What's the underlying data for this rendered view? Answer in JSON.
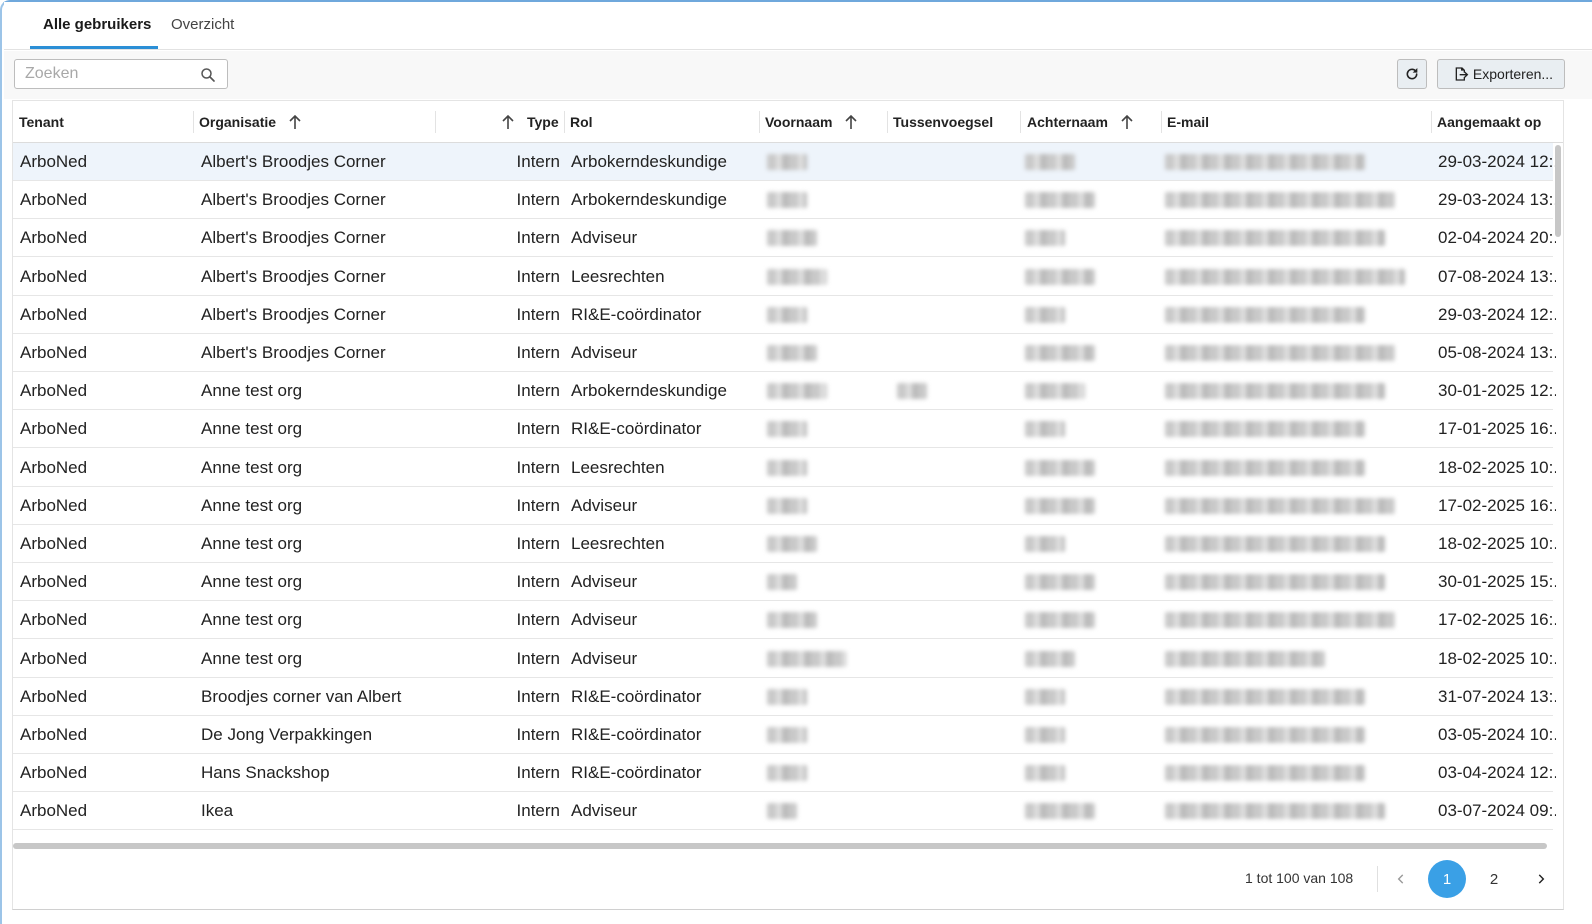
{
  "tabs": [
    {
      "label": "Alle gebruikers",
      "active": true
    },
    {
      "label": "Overzicht",
      "active": false
    }
  ],
  "toolbar": {
    "search_placeholder": "Zoeken",
    "search_value": "",
    "export_label": "Exporteren..."
  },
  "columns": {
    "tenant": "Tenant",
    "organisatie": "Organisatie",
    "type": "Type",
    "rol": "Rol",
    "voornaam": "Voornaam",
    "tussenvoegsel": "Tussenvoegsel",
    "achternaam": "Achternaam",
    "email": "E-mail",
    "aangemaakt": "Aangemaakt op"
  },
  "rows": [
    {
      "tenant": "ArboNed",
      "organisatie": "Albert's Broodjes Corner",
      "type": "Intern",
      "rol": "Arbokerndeskundige",
      "aangemaakt": "29-03-2024 12:.",
      "selected": true
    },
    {
      "tenant": "ArboNed",
      "organisatie": "Albert's Broodjes Corner",
      "type": "Intern",
      "rol": "Arbokerndeskundige",
      "aangemaakt": "29-03-2024 13:."
    },
    {
      "tenant": "ArboNed",
      "organisatie": "Albert's Broodjes Corner",
      "type": "Intern",
      "rol": "Adviseur",
      "aangemaakt": "02-04-2024 20:."
    },
    {
      "tenant": "ArboNed",
      "organisatie": "Albert's Broodjes Corner",
      "type": "Intern",
      "rol": "Leesrechten",
      "aangemaakt": "07-08-2024 13:."
    },
    {
      "tenant": "ArboNed",
      "organisatie": "Albert's Broodjes Corner",
      "type": "Intern",
      "rol": "RI&E-coördinator",
      "aangemaakt": "29-03-2024 12:."
    },
    {
      "tenant": "ArboNed",
      "organisatie": "Albert's Broodjes Corner",
      "type": "Intern",
      "rol": "Adviseur",
      "aangemaakt": "05-08-2024 13:."
    },
    {
      "tenant": "ArboNed",
      "organisatie": "Anne test org",
      "type": "Intern",
      "rol": "Arbokerndeskundige",
      "aangemaakt": "30-01-2025 12:.",
      "tussen": true
    },
    {
      "tenant": "ArboNed",
      "organisatie": "Anne test org",
      "type": "Intern",
      "rol": "RI&E-coördinator",
      "aangemaakt": "17-01-2025 16:."
    },
    {
      "tenant": "ArboNed",
      "organisatie": "Anne test org",
      "type": "Intern",
      "rol": "Leesrechten",
      "aangemaakt": "18-02-2025 10:."
    },
    {
      "tenant": "ArboNed",
      "organisatie": "Anne test org",
      "type": "Intern",
      "rol": "Adviseur",
      "aangemaakt": "17-02-2025 16:."
    },
    {
      "tenant": "ArboNed",
      "organisatie": "Anne test org",
      "type": "Intern",
      "rol": "Leesrechten",
      "aangemaakt": "18-02-2025 10:."
    },
    {
      "tenant": "ArboNed",
      "organisatie": "Anne test org",
      "type": "Intern",
      "rol": "Adviseur",
      "aangemaakt": "30-01-2025 15:."
    },
    {
      "tenant": "ArboNed",
      "organisatie": "Anne test org",
      "type": "Intern",
      "rol": "Adviseur",
      "aangemaakt": "17-02-2025 16:."
    },
    {
      "tenant": "ArboNed",
      "organisatie": "Anne test org",
      "type": "Intern",
      "rol": "Adviseur",
      "aangemaakt": "18-02-2025 10:."
    },
    {
      "tenant": "ArboNed",
      "organisatie": "Broodjes corner van Albert",
      "type": "Intern",
      "rol": "RI&E-coördinator",
      "aangemaakt": "31-07-2024 13:."
    },
    {
      "tenant": "ArboNed",
      "organisatie": "De Jong Verpakkingen",
      "type": "Intern",
      "rol": "RI&E-coördinator",
      "aangemaakt": "03-05-2024 10:."
    },
    {
      "tenant": "ArboNed",
      "organisatie": "Hans Snackshop",
      "type": "Intern",
      "rol": "RI&E-coördinator",
      "aangemaakt": "03-04-2024 12:."
    },
    {
      "tenant": "ArboNed",
      "organisatie": "Ikea",
      "type": "Intern",
      "rol": "Adviseur",
      "aangemaakt": "03-07-2024 09:."
    }
  ],
  "pagination": {
    "range_text": "1 tot 100 van 108",
    "pages": [
      "1",
      "2"
    ],
    "current": "1"
  }
}
